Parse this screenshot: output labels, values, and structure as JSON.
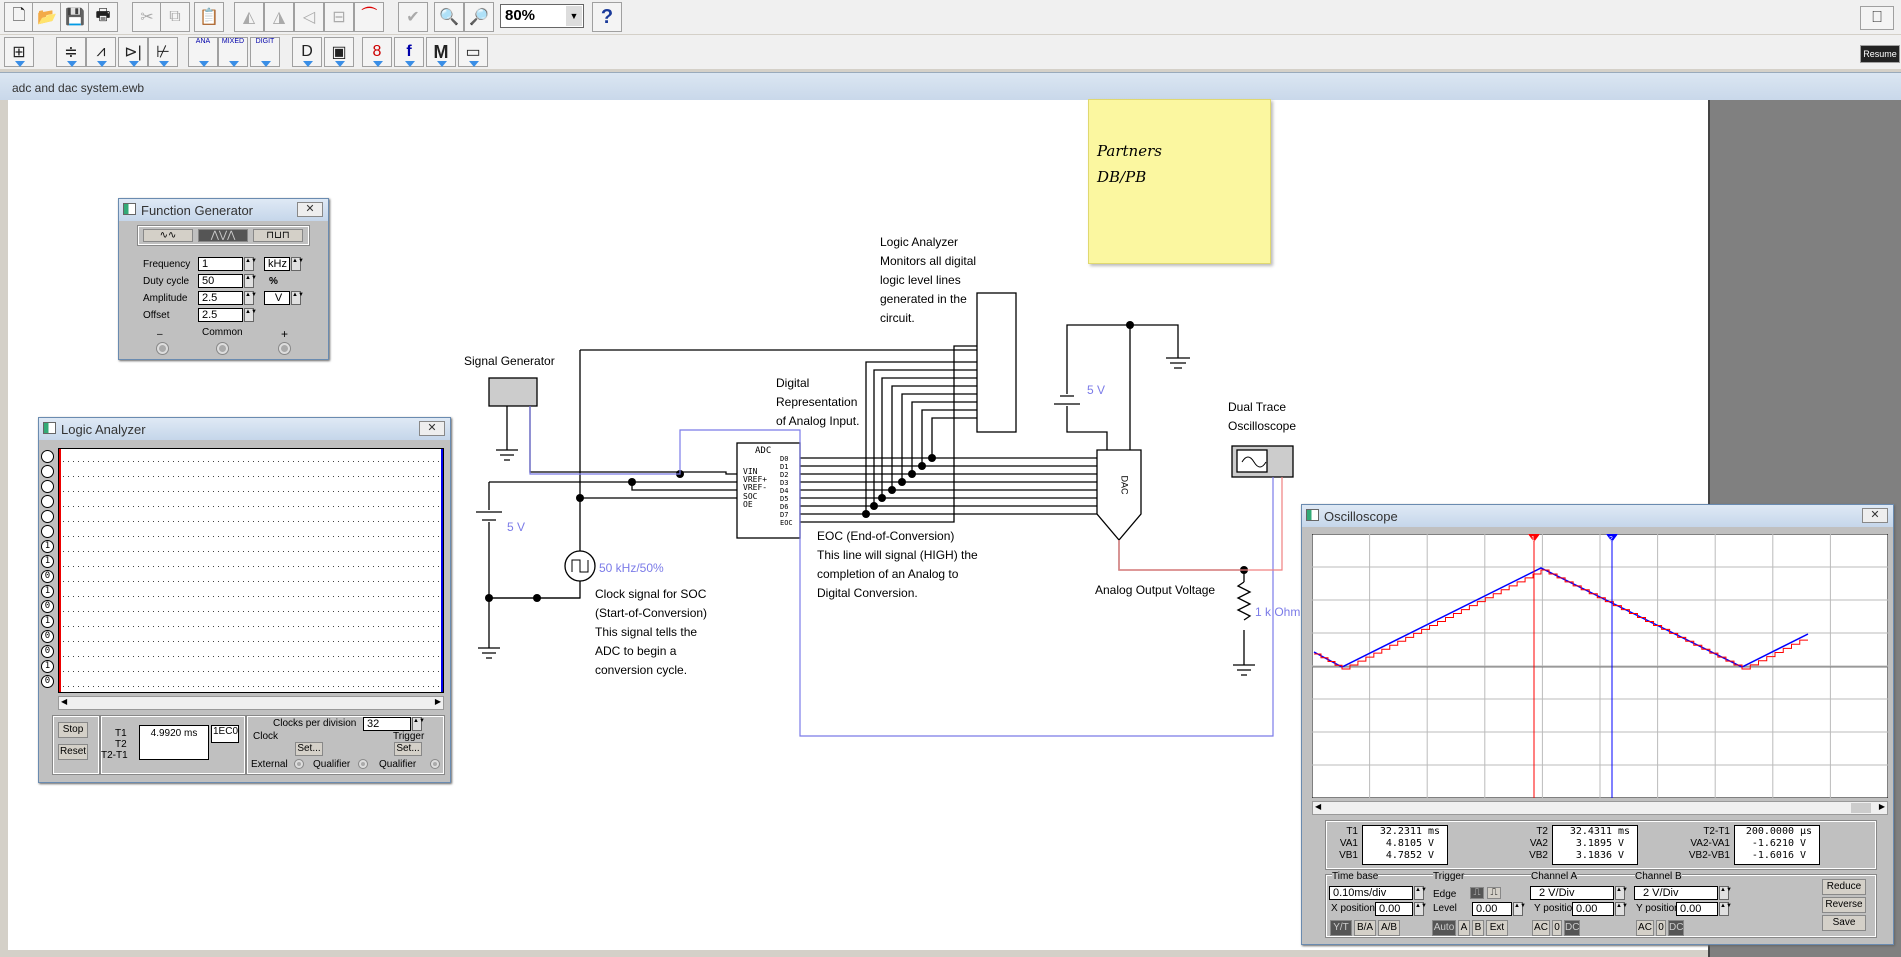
{
  "toolbar": {
    "zoom_value": "80%",
    "help": "?",
    "resume": "Resume",
    "row2_labels": {
      "ana": "ANA",
      "mixed": "MIXED",
      "digit": "DIGIT",
      "misc": "M"
    }
  },
  "document_tab": "adc and dac system.ewb",
  "sticky_note": {
    "line1": "Partners",
    "line2": "DB/PB"
  },
  "function_generator": {
    "title": "Function Generator",
    "frequency_label": "Frequency",
    "frequency": "1",
    "frequency_unit": "kHz",
    "duty_label": "Duty cycle",
    "duty": "50",
    "duty_unit": "%",
    "amplitude_label": "Amplitude",
    "amplitude": "2.5",
    "amplitude_unit": "V",
    "offset_label": "Offset",
    "offset": "2.5",
    "minus": "–",
    "common": "Common",
    "plus": "+",
    "selected_wave": "triangle"
  },
  "logic_analyzer": {
    "title": "Logic Analyzer",
    "channels": [
      "",
      "",
      "",
      "",
      "",
      "",
      "1",
      "1",
      "0",
      "1",
      "0",
      "1",
      "0",
      "0",
      "1",
      "0"
    ],
    "stop": "Stop",
    "reset": "Reset",
    "t1_label": "T1",
    "t2_label": "T2",
    "t2t1_label": "T2-T1",
    "t1_value": "4.9920 ms",
    "hex": "1EC0",
    "clocks_label": "Clocks per division",
    "clocks": "32",
    "clock_group": "Clock",
    "trigger_group": "Trigger",
    "set": "Set...",
    "external": "External",
    "qualifier": "Qualifier"
  },
  "circuit": {
    "logic_note": "Logic Analyzer\nMonitors all digital\nlogic level lines\ngenerated in the\ncircuit.",
    "signal_generator": "Signal Generator",
    "digital_rep": "Digital\nRepresentation\nof Analog Input.",
    "v1": "5 V",
    "v2": "5 V",
    "clock_value": "50 kHz/50%",
    "clock_note": "Clock signal for SOC\n(Start-of-Conversion)\nThis signal tells the\nADC to begin a\nconversion cycle.",
    "eoc_note": "EOC (End-of-Conversion)\nThis line will signal (HIGH) the\ncompletion of an Analog to\nDigital Conversion.",
    "analog_out": "Analog Output Voltage",
    "resistor": "1 k Ohm",
    "scope_label": "Dual Trace\nOscilloscope",
    "adc": {
      "title": "ADC",
      "inputs": [
        "VIN",
        "VREF+",
        "VREF-",
        "SOC",
        "OE"
      ],
      "outputs": [
        "D0",
        "D1",
        "D2",
        "D3",
        "D4",
        "D5",
        "D6",
        "D7",
        "EOC"
      ]
    },
    "dac": "DAC"
  },
  "oscilloscope": {
    "title": "Oscilloscope",
    "t1": "T1",
    "t1v": "32.2311",
    "t1u": "ms",
    "va1": "VA1",
    "va1v": "4.8105",
    "va1u": "V",
    "vb1": "VB1",
    "vb1v": "4.7852",
    "vb1u": "V",
    "t2": "T2",
    "t2v": "32.4311",
    "t2u": "ms",
    "va2": "VA2",
    "va2v": "3.1895",
    "va2u": "V",
    "vb2": "VB2",
    "vb2v": "3.1836",
    "vb2u": "V",
    "dt": "T2-T1",
    "dtv": "200.0000",
    "dtu": "µs",
    "dva": "VA2-VA1",
    "dvav": "-1.6210",
    "dvau": "V",
    "dvb": "VB2-VB1",
    "dvbv": "-1.6016",
    "dvbu": "V",
    "timebase_label": "Time base",
    "timebase": "0.10ms/div",
    "xpos_label": "X position",
    "xpos": "0.00",
    "yt": "Y/T",
    "ba": "B/A",
    "ab": "A/B",
    "trigger_label": "Trigger",
    "edge_label": "Edge",
    "level_label": "Level",
    "level": "0.00",
    "auto": "Auto",
    "a": "A",
    "b": "B",
    "ext": "Ext",
    "cha_label": "Channel A",
    "cha_scale": "2 V/Div",
    "cha_ypos_label": "Y position",
    "cha_ypos": "0.00",
    "chb_label": "Channel B",
    "chb_scale": "2 V/Div",
    "chb_ypos_label": "Y position",
    "chb_ypos": "0.00",
    "ac": "AC",
    "zero": "0",
    "dc": "DC",
    "reduce": "Reduce",
    "reverse": "Reverse",
    "save": "Save",
    "cursor1": "1",
    "cursor2": "2",
    "colors": {
      "channel_a": "#0000ff",
      "channel_b": "#ff0000"
    }
  }
}
